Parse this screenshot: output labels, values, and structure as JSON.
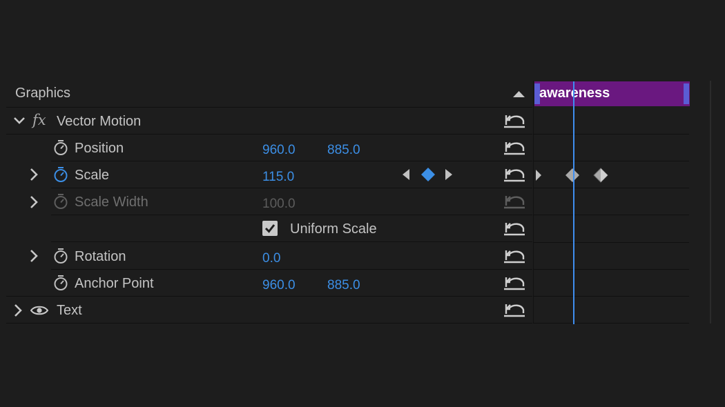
{
  "panel": {
    "title": "Graphics",
    "clip_name": "awareness"
  },
  "effect": {
    "name": "Vector Motion"
  },
  "properties": {
    "position": {
      "label": "Position",
      "x": "960.0",
      "y": "885.0"
    },
    "scale": {
      "label": "Scale",
      "value": "115.0"
    },
    "scale_width": {
      "label": "Scale Width",
      "value": "100.0"
    },
    "uniform_scale": {
      "label": "Uniform Scale",
      "checked": true
    },
    "rotation": {
      "label": "Rotation",
      "value": "0.0"
    },
    "anchor_point": {
      "label": "Anchor Point",
      "x": "960.0",
      "y": "885.0"
    }
  },
  "text_layer": {
    "label": "Text"
  },
  "colors": {
    "accent_blue": "#3c8fe6",
    "clip_purple": "#6a1880",
    "clip_handle": "#5b5cd4",
    "playhead": "#3f8ef0"
  }
}
